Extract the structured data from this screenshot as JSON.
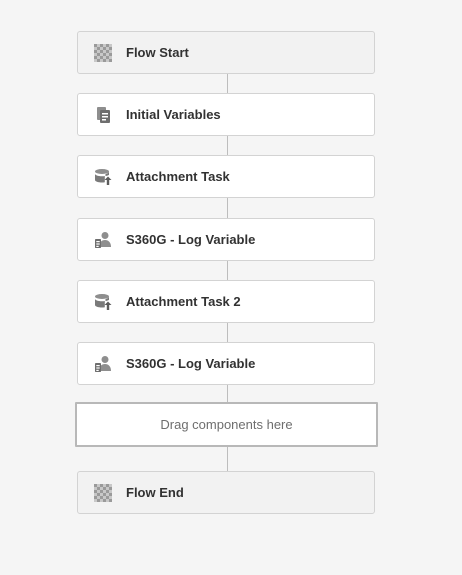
{
  "workflow": {
    "steps": [
      {
        "label": "Flow Start",
        "icon": "checkerboard-icon",
        "kind": "terminal"
      },
      {
        "label": "Initial Variables",
        "icon": "variables-document-icon",
        "kind": "step"
      },
      {
        "label": "Attachment Task",
        "icon": "attachment-task-icon",
        "kind": "step"
      },
      {
        "label": "S360G - Log Variable",
        "icon": "log-variable-user-icon",
        "kind": "step"
      },
      {
        "label": "Attachment Task 2",
        "icon": "attachment-task-icon",
        "kind": "step"
      },
      {
        "label": "S360G - Log Variable",
        "icon": "log-variable-user-icon",
        "kind": "step"
      }
    ],
    "dropzone_label": "Drag components here",
    "end": {
      "label": "Flow End",
      "icon": "checkerboard-icon",
      "kind": "terminal"
    }
  }
}
